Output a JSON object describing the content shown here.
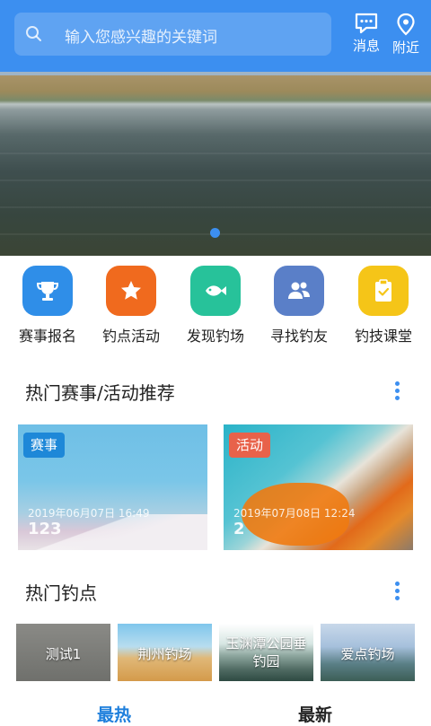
{
  "search": {
    "placeholder": "输入您感兴趣的关键词"
  },
  "header": {
    "messages_label": "消息",
    "nearby_label": "附近"
  },
  "banner": {
    "slide_index": 1,
    "slide_count": 1
  },
  "menu": [
    {
      "label": "赛事报名",
      "icon": "trophy-icon",
      "color": "#2f8ee8"
    },
    {
      "label": "钓点活动",
      "icon": "star-icon",
      "color": "#f06a1e"
    },
    {
      "label": "发现钓场",
      "icon": "fish-icon",
      "color": "#27c29a"
    },
    {
      "label": "寻找钓友",
      "icon": "people-icon",
      "color": "#5a7fc8"
    },
    {
      "label": "钓技课堂",
      "icon": "clipboard-icon",
      "color": "#f5c518"
    }
  ],
  "hot_events": {
    "title": "热门赛事/活动推荐",
    "cards": [
      {
        "tag": "赛事",
        "date": "2019年06月07日 16:49",
        "num": "123"
      },
      {
        "tag": "活动",
        "date": "2019年07月08日 12:24",
        "num": "2"
      }
    ]
  },
  "hot_spots": {
    "title": "热门钓点",
    "items": [
      "测试1",
      "荆州钓场",
      "玉渊潭公园垂钓园",
      "爱点钓场"
    ]
  },
  "tabs": {
    "hot": "最热",
    "new": "最新"
  },
  "colors": {
    "accent": "#3c8ff0",
    "tab_active": "#1e7fdc"
  }
}
